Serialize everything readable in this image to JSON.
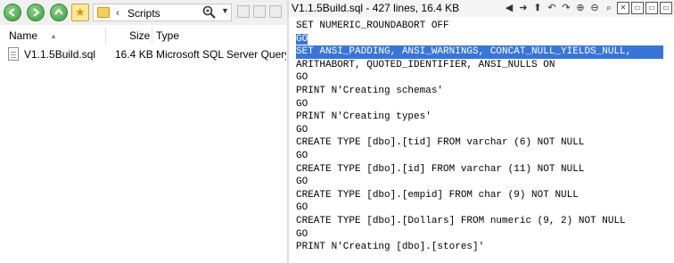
{
  "browser": {
    "address": {
      "path": "Scripts",
      "chevron": "‹"
    },
    "columns": {
      "name": "Name",
      "size": "Size",
      "type": "Type"
    },
    "files": [
      {
        "name": "V1.1.5Build.sql",
        "size": "16.4 KB",
        "type": "Microsoft SQL Server Query F"
      }
    ]
  },
  "viewer": {
    "title": "V1.1.5Build.sql - 427 lines, 16.4 KB",
    "toolbar_icons": [
      "back-arrow-icon",
      "forward-arrow-icon",
      "up-arrow-icon",
      "undo-icon",
      "redo-icon",
      "zoom-in-icon",
      "zoom-out-icon",
      "wrap-icon",
      "close-icon",
      "box-icon",
      "box-icon",
      "box-icon"
    ],
    "lines": [
      "SET NUMERIC_ROUNDABORT OFF",
      "GO",
      "SET ANSI_PADDING, ANSI_WARNINGS, CONCAT_NULL_YIELDS_NULL,",
      "ARITHABORT, QUOTED_IDENTIFIER, ANSI_NULLS ON",
      "GO",
      "PRINT N'Creating schemas'",
      "GO",
      "PRINT N'Creating types'",
      "GO",
      "CREATE TYPE [dbo].[tid] FROM varchar (6) NOT NULL",
      "GO",
      "CREATE TYPE [dbo].[id] FROM varchar (11) NOT NULL",
      "GO",
      "CREATE TYPE [dbo].[empid] FROM char (9) NOT NULL",
      "GO",
      "CREATE TYPE [dbo].[Dollars] FROM numeric (9, 2) NOT NULL",
      "GO",
      "PRINT N'Creating [dbo].[stores]'"
    ],
    "selection_color": "#3875d7"
  }
}
